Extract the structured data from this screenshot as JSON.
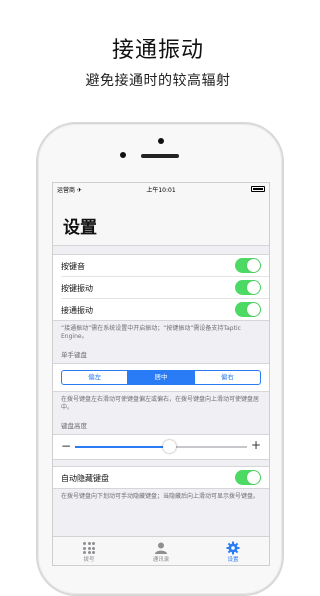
{
  "promo": {
    "title": "接通振动",
    "subtitle": "避免接通时的较高辐射"
  },
  "status_bar": {
    "carrier": "运营商 ✈",
    "time": "上午10:01"
  },
  "nav": {
    "title": "设置"
  },
  "toggles": [
    {
      "label": "按键音",
      "on": true
    },
    {
      "label": "按键振动",
      "on": true
    },
    {
      "label": "接通振动",
      "on": true
    }
  ],
  "vibration_note": "“接通振动”需在系统设置中开启振动；“按键振动”需设备支持Taptic Engine。",
  "one_hand": {
    "header": "单手键盘",
    "options": [
      "偏左",
      "居中",
      "偏右"
    ],
    "selected": "居中",
    "note": "在拨号键盘左右滑动可使键盘偏左或偏右，在拨号键盘向上滑动可使键盘居中。"
  },
  "keyboard_height": {
    "header": "键盘高度",
    "minus": "−",
    "plus": "+",
    "value": 0.55
  },
  "auto_hide": {
    "label": "自动隐藏键盘",
    "on": true,
    "note": "在拨号键盘向下划动可手动隐藏键盘；当隐藏后向上滑动可显示拨号键盘。"
  },
  "tabs": [
    {
      "label": "拨号",
      "icon": "keypad-icon",
      "active": false
    },
    {
      "label": "通讯录",
      "icon": "person-icon",
      "active": false
    },
    {
      "label": "设置",
      "icon": "gear-icon",
      "active": true
    }
  ],
  "colors": {
    "accent": "#2a7cf6",
    "switch_on": "#4cd964",
    "background": "#efeff4"
  }
}
